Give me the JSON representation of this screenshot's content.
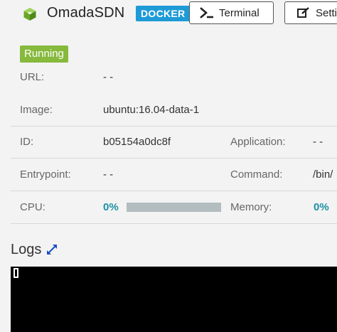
{
  "header": {
    "app_icon": "green-cube-icon",
    "title": "OmadaSDN",
    "badge": "DOCKER",
    "badge_color": "#1e9bd7",
    "terminal_button": {
      "label": "Terminal",
      "icon": "terminal-icon"
    },
    "settings_button": {
      "label": "Setti",
      "icon": "edit-icon"
    }
  },
  "status": {
    "label": "Running",
    "color": "#86b93c"
  },
  "info": {
    "url": {
      "label": "URL:",
      "value": "- -"
    },
    "image": {
      "label": "Image:",
      "value": "ubuntu:16.04-data-1"
    },
    "id": {
      "label": "ID:",
      "value": "b05154a0dc8f"
    },
    "application": {
      "label": "Application:",
      "value": "- -"
    },
    "entrypoint": {
      "label": "Entrypoint:",
      "value": "- -"
    },
    "command": {
      "label": "Command:",
      "value": "/bin/"
    },
    "cpu": {
      "label": "CPU:",
      "value": "0%",
      "usage_fraction": 0
    },
    "memory": {
      "label": "Memory:",
      "value": "0%"
    }
  },
  "logs": {
    "title": "Logs",
    "expand_icon": "expand-icon"
  },
  "accent_color": "#1e8fa3"
}
